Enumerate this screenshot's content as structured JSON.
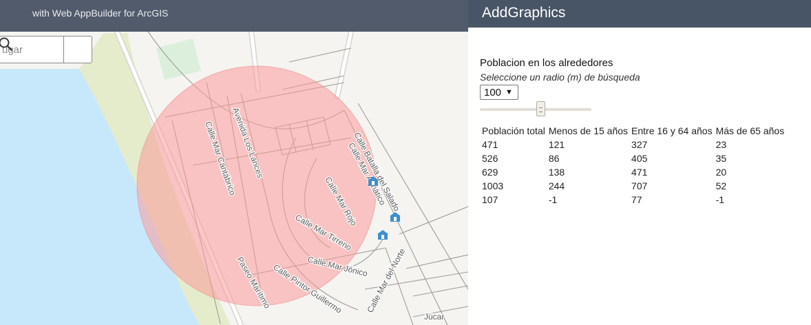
{
  "app": {
    "subtitle": "with Web AppBuilder for ArcGIS"
  },
  "search": {
    "placeholder": "ugar",
    "button_icon": "search-icon"
  },
  "map": {
    "buffer_color": "#f99a9a",
    "street_labels": [
      "Avenida Los Lances",
      "Calle Mar Cantábrico",
      "Calle Batalla del Salado",
      "Calle Mar Adriático",
      "Calle Mar Rojo",
      "Calle Mar Tirreno",
      "Calle Mar Jónico",
      "Paseo Marítimo",
      "Calle Pintor Guillermo",
      "Calle Mar del Norte",
      "Júcar"
    ],
    "poi_icon": "school-icon"
  },
  "panel": {
    "title": "AddGraphics",
    "section_title": "Poblacion en los alrededores",
    "radius_hint": "Seleccione un radio (m) de búsqueda",
    "radius_value": "100",
    "slider_level": 0.55
  },
  "table": {
    "headers": [
      "Población total",
      "Menos de 15 años",
      "Entre 16 y 64 años",
      "Más de 65 años"
    ],
    "rows": [
      [
        "471",
        "121",
        "327",
        "23"
      ],
      [
        "526",
        "86",
        "405",
        "35"
      ],
      [
        "629",
        "138",
        "471",
        "20"
      ],
      [
        "1003",
        "244",
        "707",
        "52"
      ],
      [
        "107",
        "-1",
        "77",
        "-1"
      ]
    ]
  }
}
